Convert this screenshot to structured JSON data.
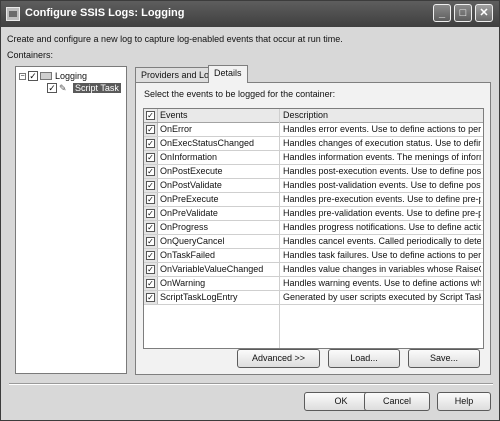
{
  "window": {
    "title": "Configure SSIS Logs: Logging",
    "controls": [
      "_",
      "□",
      "✕"
    ]
  },
  "description": "Create and configure a new log to capture log-enabled events that occur at run time.",
  "containers_label": "Containers:",
  "tree": [
    {
      "label": "Logging",
      "checked": true,
      "expander": "−"
    },
    {
      "label": "Script Task",
      "checked": true,
      "selected": true
    }
  ],
  "tabs": [
    {
      "label": "Providers and Logs",
      "active": false
    },
    {
      "label": "Details",
      "active": true
    }
  ],
  "details": {
    "select_label": "Select the events to be logged for the container:",
    "header": {
      "events": "Events",
      "description": "Description"
    },
    "rows": [
      {
        "event": "OnError",
        "description": "Handles error events. Use to define actions to perform when an error occurs.",
        "checked": true
      },
      {
        "event": "OnExecStatusChanged",
        "description": "Handles changes of execution status. Use to define actions to perform when status changes.",
        "checked": true
      },
      {
        "event": "OnInformation",
        "description": "Handles information events. The menings of information events are task-defined.",
        "checked": true
      },
      {
        "event": "OnPostExecute",
        "description": "Handles post-execution events. Use to define post-processing actions.",
        "checked": true
      },
      {
        "event": "OnPostValidate",
        "description": "Handles post-validation events. Use to define post-processing actions.",
        "checked": true
      },
      {
        "event": "OnPreExecute",
        "description": "Handles pre-execution events. Use to define pre-processing actions.",
        "checked": true
      },
      {
        "event": "OnPreValidate",
        "description": "Handles pre-validation events. Use to define pre-processing actions.",
        "checked": true
      },
      {
        "event": "OnProgress",
        "description": "Handles progress notifications. Use to define actions on progress.",
        "checked": true
      },
      {
        "event": "OnQueryCancel",
        "description": "Handles cancel events. Called periodically to determine cancellation.",
        "checked": true
      },
      {
        "event": "OnTaskFailed",
        "description": "Handles task failures. Use to define actions to perform on failure.",
        "checked": true
      },
      {
        "event": "OnVariableValueChanged",
        "description": "Handles value changes in variables whose RaiseChangedEvent is true.",
        "checked": true
      },
      {
        "event": "OnWarning",
        "description": "Handles warning events. Use to define actions when warnings occur.",
        "checked": true
      },
      {
        "event": "ScriptTaskLogEntry",
        "description": "Generated by user scripts executed by Script Task",
        "checked": true
      }
    ],
    "buttons": {
      "advanced": "Advanced >>",
      "load": "Load...",
      "save": "Save..."
    }
  },
  "footer": {
    "ok": "OK",
    "cancel": "Cancel",
    "help": "Help"
  }
}
